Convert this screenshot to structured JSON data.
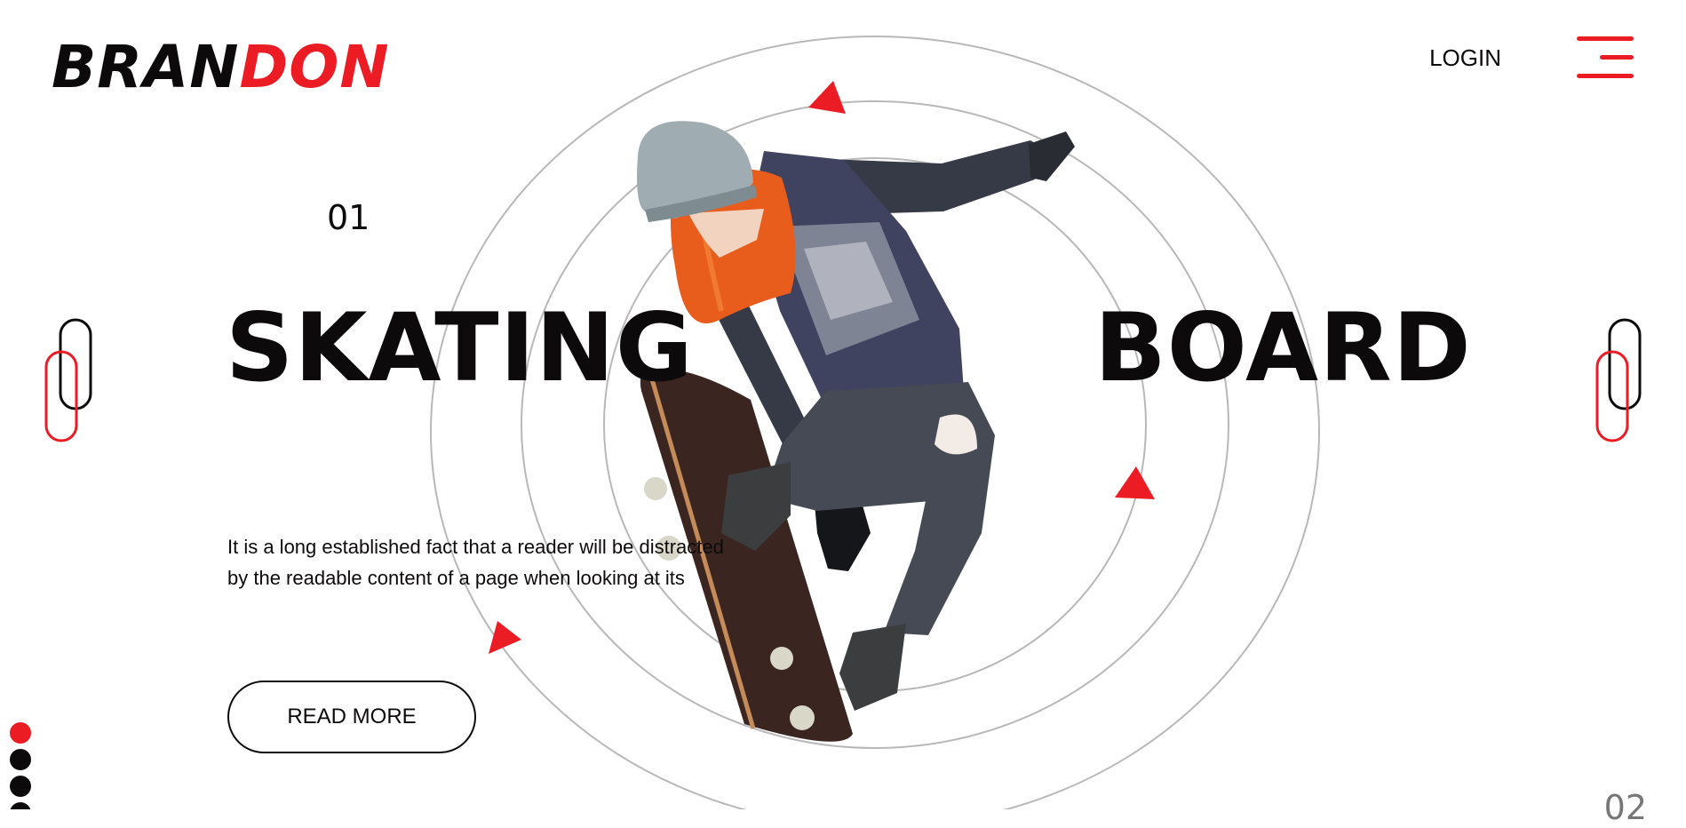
{
  "header": {
    "logo_part1": "BRAN",
    "logo_part2": "DON",
    "login_label": "LOGIN",
    "menu_icon": "hamburger-menu-icon"
  },
  "hero": {
    "slide_number": "01",
    "next_slide_number": "02",
    "title_left": "SKATING",
    "title_right": "BOARD",
    "description": "It is a long established fact that a reader will be distracted by the readable content of a page when looking at its",
    "read_more_label": "READ MORE",
    "image_alt": "Skateboarder mid-air trick"
  },
  "pagination": {
    "dots": 4,
    "active_index": 0
  },
  "colors": {
    "accent": "#ec1c24",
    "text": "#0d0a0b",
    "background": "#ffffff",
    "ring": "#b8b8b8"
  },
  "icons": [
    "hamburger-menu-icon",
    "prev-arrow-icon",
    "next-arrow-icon",
    "triangle-icon"
  ]
}
